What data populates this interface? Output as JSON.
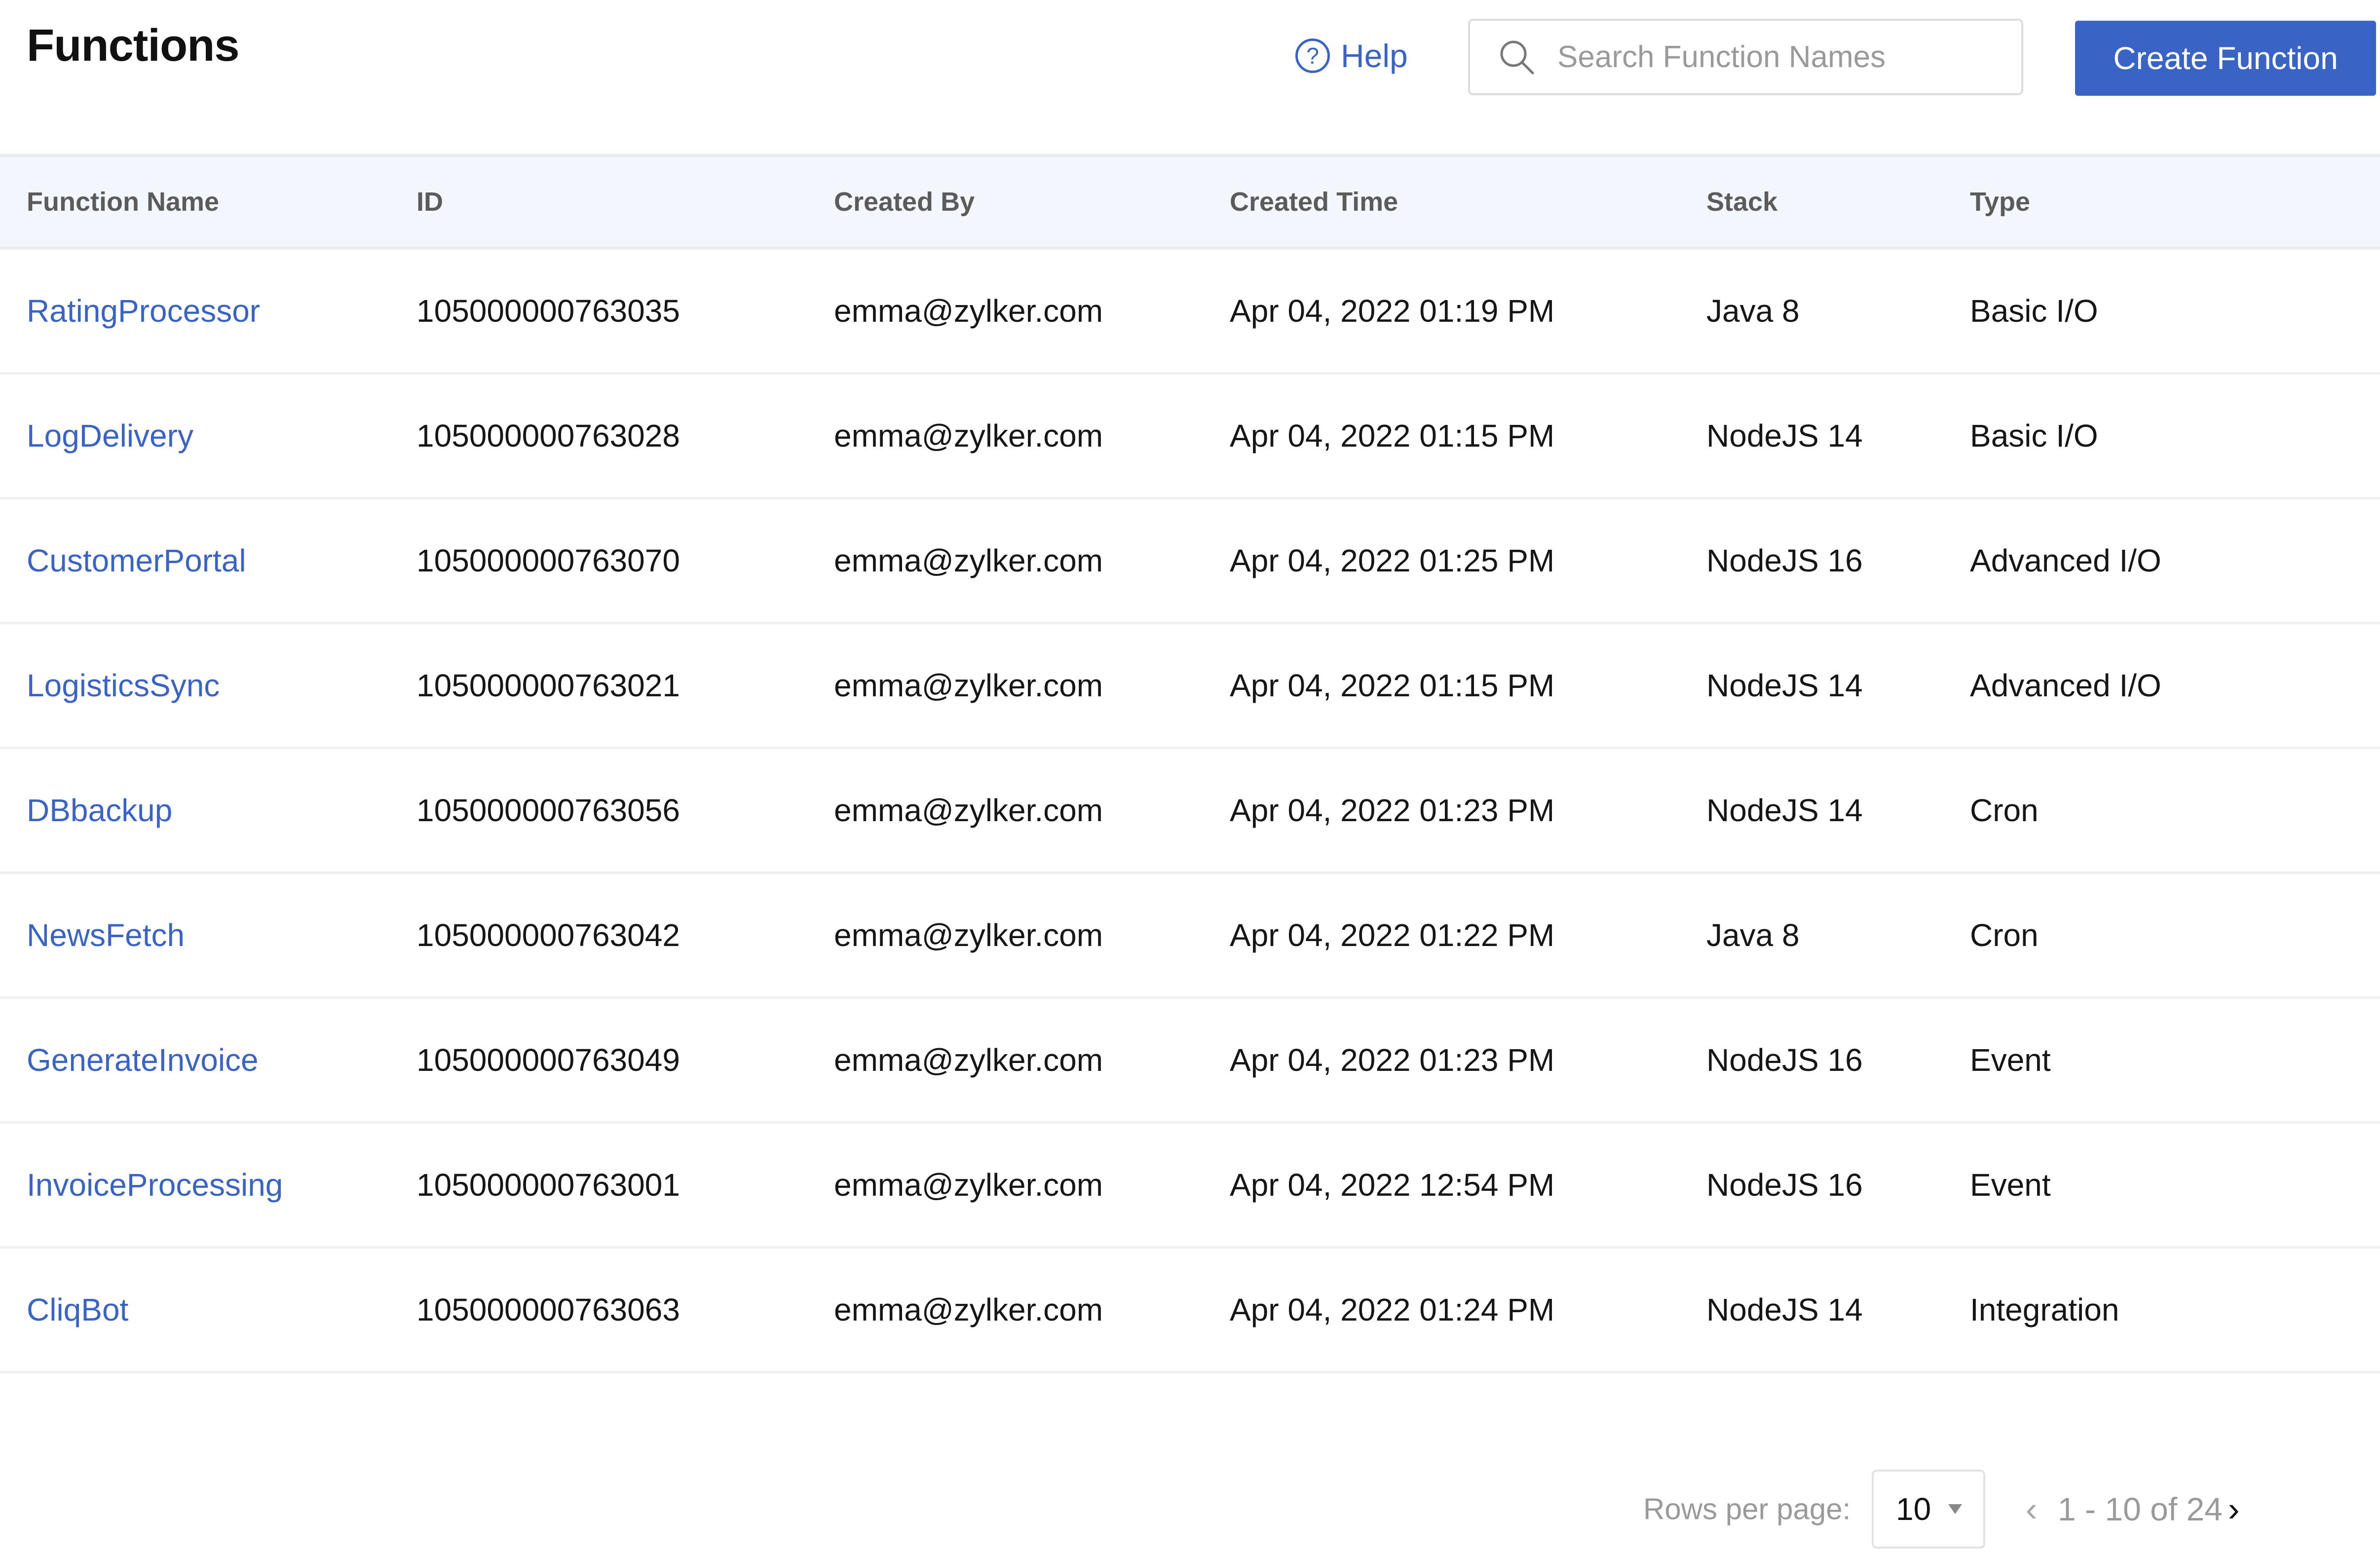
{
  "header": {
    "title": "Functions",
    "help_label": "Help",
    "help_icon": "question-circle-icon",
    "search": {
      "placeholder": "Search Function Names",
      "value": "",
      "icon": "search-icon"
    },
    "create_button_label": "Create Function",
    "accent_color": "#3a63c6"
  },
  "table": {
    "columns": [
      "Function Name",
      "ID",
      "Created By",
      "Created Time",
      "Stack",
      "Type"
    ],
    "rows": [
      {
        "name": "RatingProcessor",
        "id": "105000000763035",
        "created_by": "emma@zylker.com",
        "created_time": "Apr 04, 2022 01:19 PM",
        "stack": "Java 8",
        "type": "Basic I/O"
      },
      {
        "name": "LogDelivery",
        "id": "105000000763028",
        "created_by": "emma@zylker.com",
        "created_time": "Apr 04, 2022 01:15 PM",
        "stack": "NodeJS 14",
        "type": "Basic I/O"
      },
      {
        "name": "CustomerPortal",
        "id": "105000000763070",
        "created_by": "emma@zylker.com",
        "created_time": "Apr 04, 2022 01:25 PM",
        "stack": "NodeJS 16",
        "type": "Advanced I/O"
      },
      {
        "name": "LogisticsSync",
        "id": "105000000763021",
        "created_by": "emma@zylker.com",
        "created_time": "Apr 04, 2022 01:15 PM",
        "stack": "NodeJS 14",
        "type": "Advanced I/O"
      },
      {
        "name": "DBbackup",
        "id": "105000000763056",
        "created_by": "emma@zylker.com",
        "created_time": "Apr 04, 2022 01:23 PM",
        "stack": "NodeJS 14",
        "type": "Cron"
      },
      {
        "name": "NewsFetch",
        "id": "105000000763042",
        "created_by": "emma@zylker.com",
        "created_time": "Apr 04, 2022 01:22 PM",
        "stack": "Java 8",
        "type": "Cron"
      },
      {
        "name": "GenerateInvoice",
        "id": "105000000763049",
        "created_by": "emma@zylker.com",
        "created_time": "Apr 04, 2022 01:23 PM",
        "stack": "NodeJS 16",
        "type": "Event"
      },
      {
        "name": "InvoiceProcessing",
        "id": "105000000763001",
        "created_by": "emma@zylker.com",
        "created_time": "Apr 04, 2022 12:54 PM",
        "stack": "NodeJS 16",
        "type": "Event"
      },
      {
        "name": "CliqBot",
        "id": "105000000763063",
        "created_by": "emma@zylker.com",
        "created_time": "Apr 04, 2022 01:24 PM",
        "stack": "NodeJS 14",
        "type": "Integration"
      }
    ]
  },
  "pagination": {
    "rows_per_page_label": "Rows per page:",
    "rows_per_page_value": "10",
    "range_text": "1 - 10 of 24",
    "prev_icon": "chevron-left-icon",
    "next_icon": "chevron-right-icon",
    "prev_glyph": "‹",
    "next_glyph": "›"
  }
}
